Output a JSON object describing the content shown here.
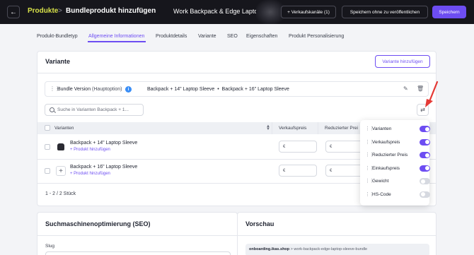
{
  "header": {
    "back_icon": "arrow-left-icon",
    "breadcrumb_root": "Produkte",
    "breadcrumb_separator": ">",
    "breadcrumb_current": "Bundleprodukt hinzufügen",
    "product_name": "Work Backpack & Edge Lapto",
    "sales_channels_label": "+ Verkaufskanäle (1)",
    "save_draft_label": "Speichern ohne zu veröffentlichen",
    "save_label": "Speichern",
    "accent_color": "#6d4df2",
    "brand_color": "#d8e24a"
  },
  "tabs": [
    {
      "label": "Produkt-Bundletyp"
    },
    {
      "label": "Allgemeine Informationen",
      "active": true
    },
    {
      "label": "Produktdetails"
    },
    {
      "label": "Variante"
    },
    {
      "label": "SEO"
    },
    {
      "label": "Eigenschaften"
    },
    {
      "label": "Produkt Personalisierung"
    }
  ],
  "variants": {
    "title": "Variante",
    "add_variant_label": "Variante hinzufügen",
    "bundle": {
      "label": "Bundle Version",
      "hint": "(Hauptoption)",
      "info_icon": "i",
      "item_1": "Backpack + 14\" Laptop Sleeve",
      "separator": "•",
      "item_2": "Backpack + 16\" Laptop Sleeve"
    },
    "search_placeholder": "Suche in Varianten Backpack + 1...",
    "columns": [
      "Varianten",
      "Verkaufspreis",
      "Reduzierter Prei"
    ],
    "rows": [
      {
        "name": "Backpack + 14\" Laptop Sleeve",
        "link": "+ Produkt hinzufügen",
        "currency_1": "€",
        "currency_2": "€"
      },
      {
        "name": "Backpack + 16\" Laptop Sleeve",
        "link": "+ Produkt hinzufügen",
        "currency_1": "€",
        "currency_2": "€"
      }
    ],
    "count_label": "1 - 2 / 2 Stück"
  },
  "column_popover": {
    "items": [
      {
        "label": "Varianten",
        "enabled": true
      },
      {
        "label": "Verkaufspreis",
        "enabled": true
      },
      {
        "label": "Reduzierter Preis",
        "enabled": true
      },
      {
        "label": "Einkaufspreis",
        "enabled": true
      },
      {
        "label": "Gewicht",
        "enabled": false
      },
      {
        "label": "HS-Code",
        "enabled": false
      }
    ]
  },
  "seo": {
    "title": "Suchmaschinenoptimierung (SEO)",
    "slug_label": "Slug"
  },
  "preview": {
    "title": "Vorschau",
    "domain": "onboarding.ikas.shop",
    "path": " > work-backpack-edge-laptop-sleeve-bundle"
  },
  "annotation": {
    "arrow_color": "#e53935"
  }
}
